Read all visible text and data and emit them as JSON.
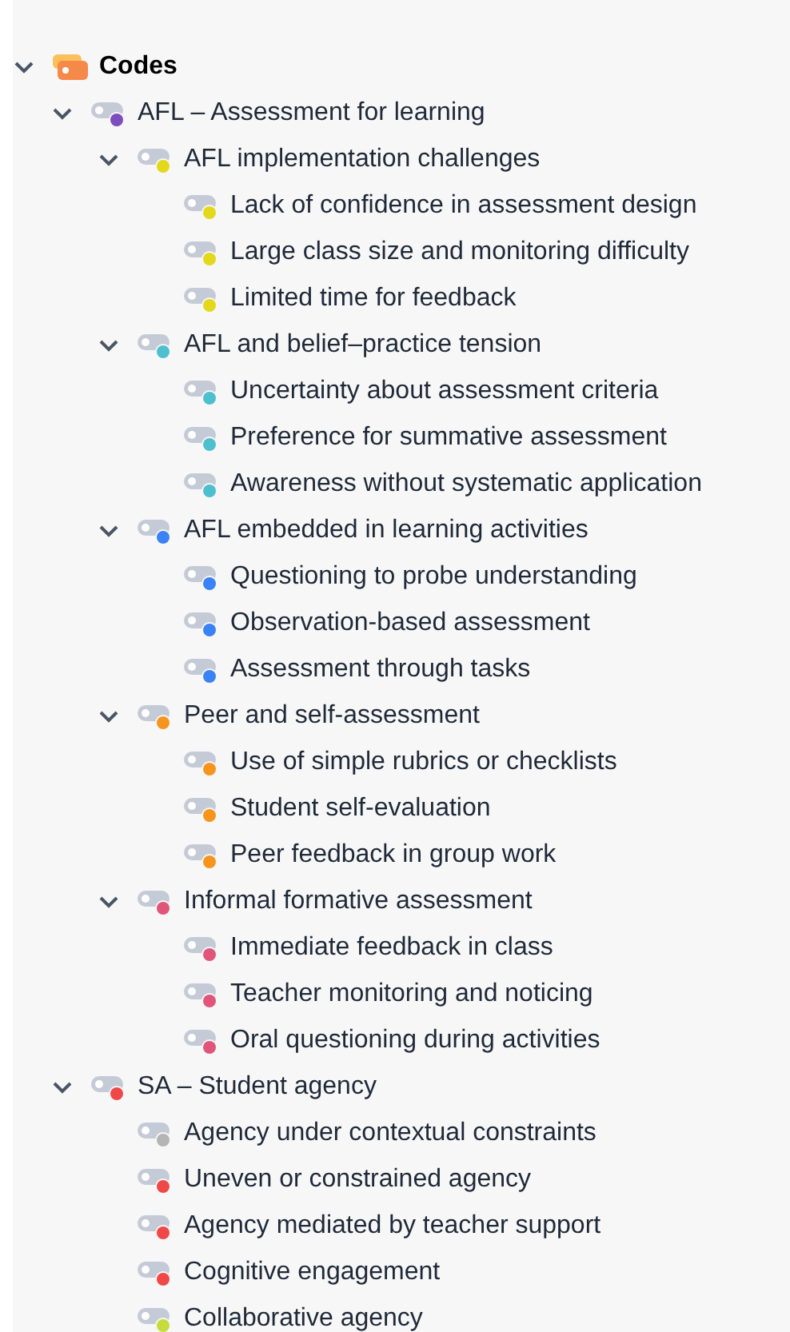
{
  "tree": [
    {
      "label": "Codes",
      "kind": "root",
      "expanded": true,
      "children": [
        {
          "label": "AFL – Assessment for learning",
          "color": "#7c4dbd",
          "expanded": true,
          "children": [
            {
              "label": "AFL implementation challenges",
              "color": "#e3d81b",
              "expanded": true,
              "children": [
                {
                  "label": "Lack of confidence in assessment design",
                  "color": "#e3d81b"
                },
                {
                  "label": "Large class size and monitoring difficulty",
                  "color": "#e3d81b"
                },
                {
                  "label": "Limited time for feedback",
                  "color": "#e3d81b"
                }
              ]
            },
            {
              "label": "AFL and belief–practice tension",
              "color": "#4dbfcf",
              "expanded": true,
              "children": [
                {
                  "label": "Uncertainty about assessment criteria",
                  "color": "#4dbfcf"
                },
                {
                  "label": "Preference for summative assessment",
                  "color": "#4dbfcf"
                },
                {
                  "label": "Awareness without systematic application",
                  "color": "#4dbfcf"
                }
              ]
            },
            {
              "label": "AFL embedded in learning activities",
              "color": "#3b82f6",
              "expanded": true,
              "children": [
                {
                  "label": "Questioning to probe understanding",
                  "color": "#3b82f6"
                },
                {
                  "label": "Observation-based assessment",
                  "color": "#3b82f6"
                },
                {
                  "label": "Assessment through tasks",
                  "color": "#3b82f6"
                }
              ]
            },
            {
              "label": "Peer and self-assessment",
              "color": "#f7941d",
              "expanded": true,
              "children": [
                {
                  "label": "Use of simple rubrics or checklists",
                  "color": "#f7941d"
                },
                {
                  "label": "Student self-evaluation",
                  "color": "#f7941d"
                },
                {
                  "label": "Peer feedback in group work",
                  "color": "#f7941d"
                }
              ]
            },
            {
              "label": "Informal formative assessment",
              "color": "#e0557a",
              "expanded": true,
              "children": [
                {
                  "label": "Immediate feedback in class",
                  "color": "#e0557a"
                },
                {
                  "label": "Teacher monitoring and noticing",
                  "color": "#e0557a"
                },
                {
                  "label": "Oral questioning during activities",
                  "color": "#e0557a"
                }
              ]
            }
          ]
        },
        {
          "label": "SA – Student agency",
          "color": "#f04848",
          "expanded": true,
          "children": [
            {
              "label": "Agency under contextual constraints",
              "color": "#b4b4b4"
            },
            {
              "label": "Uneven or constrained agency",
              "color": "#f04848"
            },
            {
              "label": "Agency mediated by teacher support",
              "color": "#f04848"
            },
            {
              "label": "Cognitive engagement",
              "color": "#f04848"
            },
            {
              "label": "Collaborative agency",
              "color": "#c6dc3a"
            }
          ]
        }
      ]
    }
  ]
}
